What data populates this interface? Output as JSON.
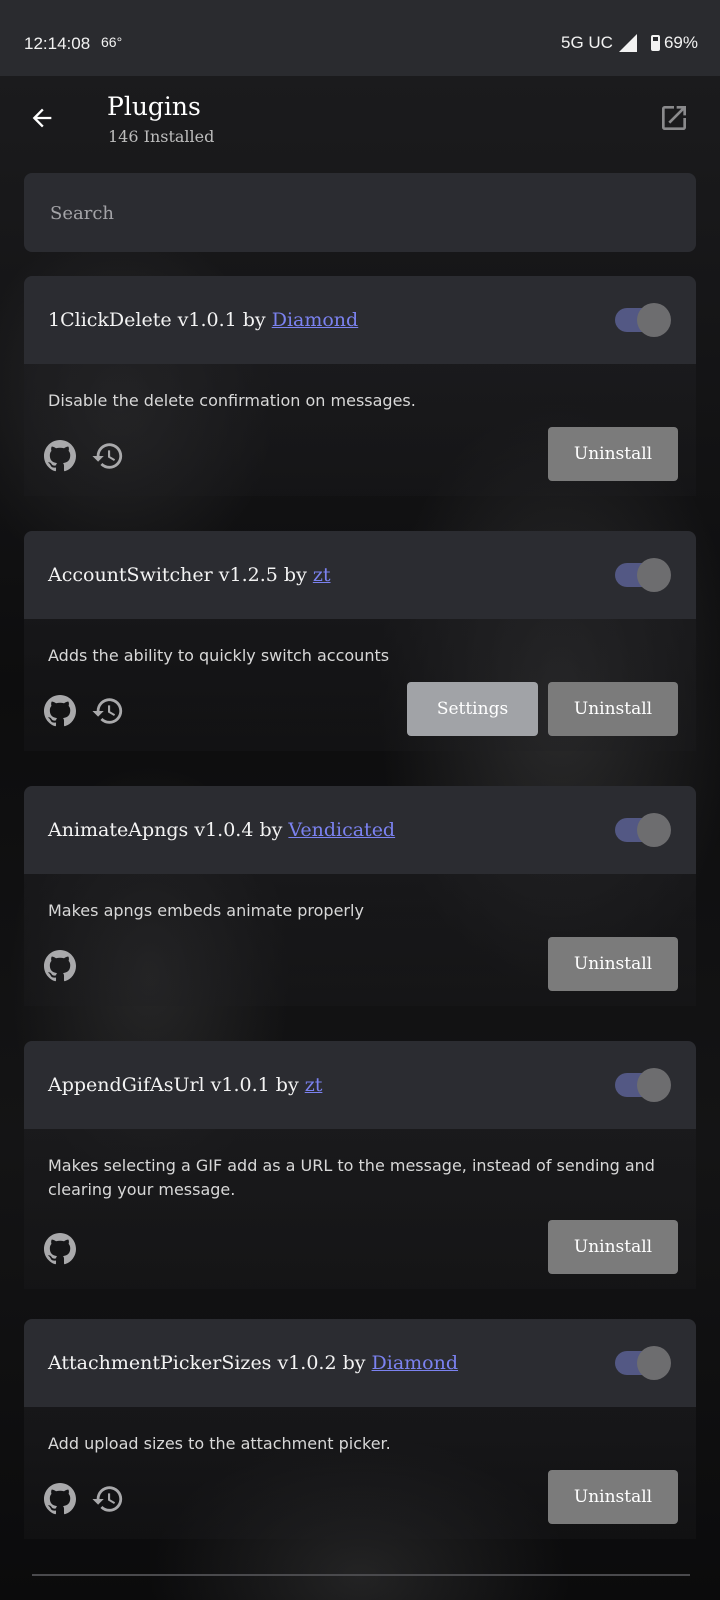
{
  "status_bar": {
    "time": "12:14:08",
    "temperature": "66°",
    "network": "5G UC",
    "battery": "69%"
  },
  "app_bar": {
    "title": "Plugins",
    "subtitle": "146 Installed"
  },
  "search": {
    "placeholder": "Search"
  },
  "plugins": [
    {
      "name": "1ClickDelete v1.0.1 by ",
      "author": "Diamond",
      "description": "Disable the delete confirmation on messages.",
      "enabled": true,
      "has_history": true,
      "has_settings": false,
      "uninstall_label": "Uninstall"
    },
    {
      "name": "AccountSwitcher v1.2.5 by ",
      "author": "zt",
      "description": "Adds the ability to quickly switch accounts",
      "enabled": true,
      "has_history": true,
      "has_settings": true,
      "settings_label": "Settings",
      "uninstall_label": "Uninstall"
    },
    {
      "name": "AnimateApngs v1.0.4 by ",
      "author": "Vendicated",
      "description": "Makes apngs embeds animate properly",
      "enabled": true,
      "has_history": false,
      "has_settings": false,
      "uninstall_label": "Uninstall"
    },
    {
      "name": "AppendGifAsUrl v1.0.1 by ",
      "author": "zt",
      "description": "Makes selecting a GIF add as a URL to the message, instead of sending and clearing your message.",
      "enabled": true,
      "has_history": false,
      "has_settings": false,
      "uninstall_label": "Uninstall"
    },
    {
      "name": "AttachmentPickerSizes v1.0.2 by ",
      "author": "Diamond",
      "description": "Add upload sizes to the attachment picker.",
      "enabled": true,
      "has_history": true,
      "has_settings": false,
      "uninstall_label": "Uninstall"
    }
  ],
  "icons": {
    "back": "arrow-back-icon",
    "open_external": "open-external-icon",
    "github": "github-icon",
    "history": "history-icon"
  },
  "colors": {
    "card": "#2b2c31",
    "toggle_track": "#535884",
    "link": "#7b82f0",
    "uninstall_button": "#7b7b7b",
    "settings_button": "#a1a3a7"
  }
}
